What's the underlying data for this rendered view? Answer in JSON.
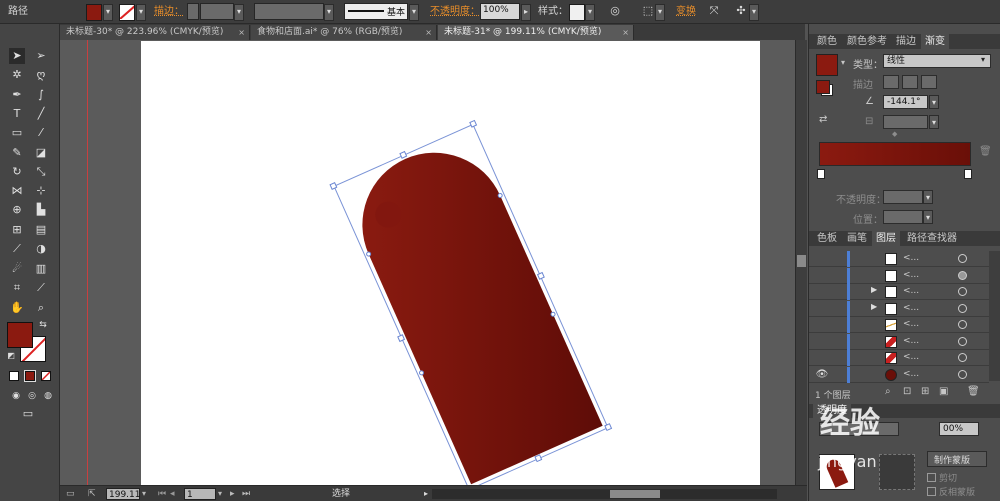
{
  "control_bar": {
    "title": "路径",
    "fill_color": "#8b1a10",
    "stroke_label": "描边：",
    "stroke_style": "基本",
    "opacity_label": "不透明度：",
    "opacity_value": "100%",
    "style_label": "样式：",
    "transform_label": "变换"
  },
  "tabs": [
    {
      "label": "未标题-30* @ 223.96% (CMYK/预览)",
      "close": "×"
    },
    {
      "label": "食物和店面.ai* @ 76% (RGB/预览)",
      "close": "×"
    },
    {
      "label": "未标题-31* @ 199.11% (CMYK/预览)",
      "close": "×"
    }
  ],
  "tools": {
    "fill_color": "#8b1a10",
    "icons": [
      "selection-icon",
      "direct-selection-icon",
      "magic-wand-icon",
      "lasso-icon",
      "pen-icon",
      "curvature-icon",
      "type-icon",
      "line-segment-icon",
      "rectangle-icon",
      "paintbrush-icon",
      "pencil-icon",
      "eraser-icon",
      "rotate-icon",
      "scale-icon",
      "width-icon",
      "free-transform-icon",
      "shape-builder-icon",
      "perspective-grid-icon",
      "mesh-icon",
      "gradient-icon",
      "eyedropper-icon",
      "blend-icon",
      "symbol-sprayer-icon",
      "column-graph-icon",
      "artboard-icon",
      "slice-icon",
      "hand-icon",
      "zoom-icon"
    ]
  },
  "status_bar": {
    "zoom": "199.11",
    "page": "1",
    "tool_name": "选择"
  },
  "color_panel": {
    "tabs": [
      "颜色",
      "颜色参考",
      "描边",
      "渐变"
    ],
    "active_tab": "渐变",
    "type_label": "类型：",
    "type_value": "线性",
    "stroke_label": "描边",
    "angle_value": "-144.1°",
    "gradient_start": "#8b1a10",
    "gradient_end": "#6a0f08",
    "opacity_label": "不透明度：",
    "position_label": "位置："
  },
  "layers_panel": {
    "tabs": [
      "色板",
      "画笔",
      "图层",
      "路径查找器"
    ],
    "active_tab": "图层",
    "rows": [
      {
        "name": "<...",
        "thumb": "white",
        "arrow": false,
        "eye": false,
        "target_filled": false
      },
      {
        "name": "<...",
        "thumb": "white",
        "arrow": false,
        "eye": false,
        "target_filled": true
      },
      {
        "name": "<...",
        "thumb": "white",
        "arrow": true,
        "eye": false,
        "target_filled": false
      },
      {
        "name": "<...",
        "thumb": "white",
        "arrow": true,
        "eye": false,
        "target_filled": false
      },
      {
        "name": "<...",
        "thumb": "line",
        "arrow": false,
        "eye": false,
        "target_filled": false
      },
      {
        "name": "<...",
        "thumb": "red-shapes",
        "arrow": false,
        "eye": false,
        "target_filled": false
      },
      {
        "name": "<...",
        "thumb": "red-shapes",
        "arrow": false,
        "eye": false,
        "target_filled": false
      },
      {
        "name": "<...",
        "thumb": "dark-red",
        "arrow": false,
        "eye": true,
        "target_filled": false
      }
    ],
    "footer": "1 个图层"
  },
  "transparency_panel": {
    "tab": "透明度",
    "opacity_value": "00%",
    "make_mask_label": "制作蒙版",
    "invert_mask_label": "反相蒙版",
    "clip_label": "剪切"
  },
  "watermark": {
    "text": "经验",
    "sub": "jingyan"
  }
}
